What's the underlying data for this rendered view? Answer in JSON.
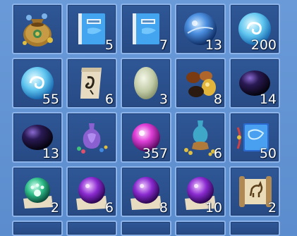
{
  "inventory": {
    "slots": [
      {
        "item": "coin-pouch-icon",
        "count": ""
      },
      {
        "item": "blue-book-icon",
        "count": "5"
      },
      {
        "item": "blue-book-icon",
        "count": "7"
      },
      {
        "item": "blue-crystal-orb-icon",
        "count": "13"
      },
      {
        "item": "swirl-orb-icon",
        "count": "200"
      },
      {
        "item": "swirl-orb-icon",
        "count": "55"
      },
      {
        "item": "rune-scroll-icon",
        "count": "6"
      },
      {
        "item": "jade-stone-icon",
        "count": "3"
      },
      {
        "item": "gem-pile-icon",
        "count": "8"
      },
      {
        "item": "dark-orb-icon",
        "count": "14"
      },
      {
        "item": "dark-orb-icon",
        "count": "13"
      },
      {
        "item": "gem-vase-icon",
        "count": ""
      },
      {
        "item": "pink-orb-icon",
        "count": "357"
      },
      {
        "item": "treasure-vase-icon",
        "count": "6"
      },
      {
        "item": "rope-book-icon",
        "count": "50"
      },
      {
        "item": "paw-orb-icon",
        "count": "2"
      },
      {
        "item": "purple-orb-scroll-icon",
        "count": "6"
      },
      {
        "item": "purple-orb-scroll-icon",
        "count": "8"
      },
      {
        "item": "purple-orb-scroll-icon",
        "count": "10"
      },
      {
        "item": "horse-map-scroll-icon",
        "count": "2"
      }
    ]
  }
}
